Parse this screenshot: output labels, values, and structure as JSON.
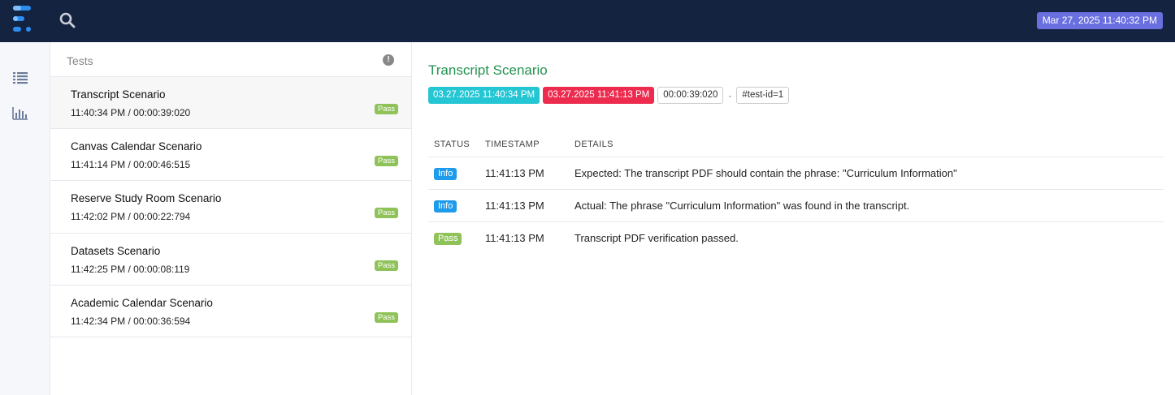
{
  "header": {
    "datetime": "Mar 27, 2025 11:40:32 PM",
    "colors": {
      "background": "#14233f",
      "datetime_badge": "#6a6fe0"
    }
  },
  "nav": {
    "items": [
      {
        "icon": "list-icon"
      },
      {
        "icon": "bar-chart-icon"
      }
    ]
  },
  "test_list": {
    "title": "Tests",
    "tests": [
      {
        "name": "Transcript Scenario",
        "meta": "11:40:34 PM / 00:00:39:020",
        "status": "Pass"
      },
      {
        "name": "Canvas Calendar Scenario",
        "meta": "11:41:14 PM / 00:00:46:515",
        "status": "Pass"
      },
      {
        "name": "Reserve Study Room Scenario",
        "meta": "11:42:02 PM / 00:00:22:794",
        "status": "Pass"
      },
      {
        "name": "Datasets Scenario",
        "meta": "11:42:25 PM / 00:00:08:119",
        "status": "Pass"
      },
      {
        "name": "Academic Calendar Scenario",
        "meta": "11:42:34 PM / 00:00:36:594",
        "status": "Pass"
      }
    ]
  },
  "detail": {
    "title": "Transcript Scenario",
    "start_time": "03.27.2025 11:40:34 PM",
    "end_time": "03.27.2025 11:41:13 PM",
    "duration": "00:00:39:020",
    "separator": "·",
    "test_id": "#test-id=1",
    "columns": [
      "STATUS",
      "TIMESTAMP",
      "DETAILS"
    ],
    "logs": [
      {
        "status": "Info",
        "timestamp": "11:41:13 PM",
        "details": "Expected: The transcript PDF should contain the phrase: \"Curriculum Information\""
      },
      {
        "status": "Info",
        "timestamp": "11:41:13 PM",
        "details": "Actual: The phrase \"Curriculum Information\" was found in the transcript."
      },
      {
        "status": "Pass",
        "timestamp": "11:41:13 PM",
        "details": "Transcript PDF verification passed."
      }
    ],
    "colors": {
      "title": "#22924f",
      "start": "#25c6d4",
      "end": "#ec2b4e",
      "info": "#1e9bea",
      "pass": "#8fc35a"
    }
  }
}
